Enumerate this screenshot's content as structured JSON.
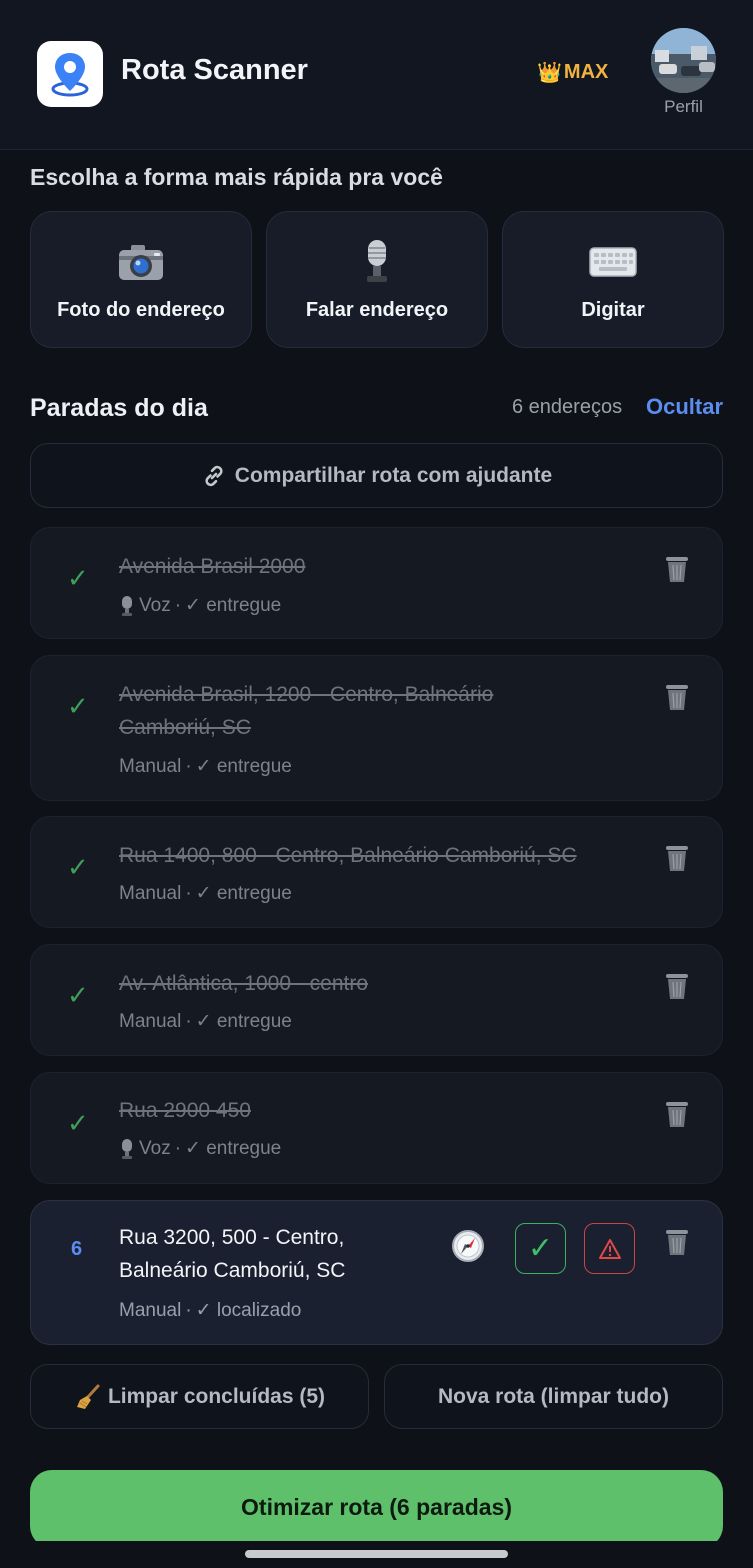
{
  "header": {
    "app_title": "Rota Scanner",
    "plan_badge": "MAX",
    "plan_icon": "crown-icon",
    "profile_label": "Perfil"
  },
  "methods": {
    "section_title": "Escolha a forma mais rápida pra você",
    "items": [
      {
        "label": "Foto do endereço",
        "icon": "camera-icon"
      },
      {
        "label": "Falar endereço",
        "icon": "microphone-icon"
      },
      {
        "label": "Digitar",
        "icon": "keyboard-icon"
      }
    ]
  },
  "stops": {
    "title": "Paradas do dia",
    "count": "6 endereços",
    "hide_label": "Ocultar",
    "share_label": "Compartilhar rota com ajudante",
    "items": [
      {
        "address": "Avenida Brasil 2000",
        "source": "Voz",
        "status": "✓ entregue",
        "done": true
      },
      {
        "address": "Avenida Brasil, 1200 - Centro, Balneário Camboriú, SC",
        "source": "Manual",
        "status": "✓ entregue",
        "done": true
      },
      {
        "address": "Rua 1400, 800 - Centro, Balneário Camboriú, SC",
        "source": "Manual",
        "status": "✓ entregue",
        "done": true
      },
      {
        "address": "Av. Atlântica, 1000 - centro",
        "source": "Manual",
        "status": "✓ entregue",
        "done": true
      },
      {
        "address": "Rua 2900 450",
        "source": "Voz",
        "status": "✓ entregue",
        "done": true
      },
      {
        "number": "6",
        "address": "Rua 3200, 500 - Centro, Balneário Camboriú, SC",
        "source": "Manual",
        "status": "✓ localizado",
        "done": false
      }
    ]
  },
  "actions": {
    "clear_done": "Limpar concluídas (5)",
    "new_route": "Nova rota (limpar tudo)",
    "optimize": "Otimizar rota (6 paradas)"
  },
  "separator": "·",
  "colors": {
    "background": "#0e1117",
    "accent_blue": "#5b8def",
    "success_green": "#5ec06b",
    "warning_red": "#c94545",
    "badge_gold": "#f0b341"
  }
}
